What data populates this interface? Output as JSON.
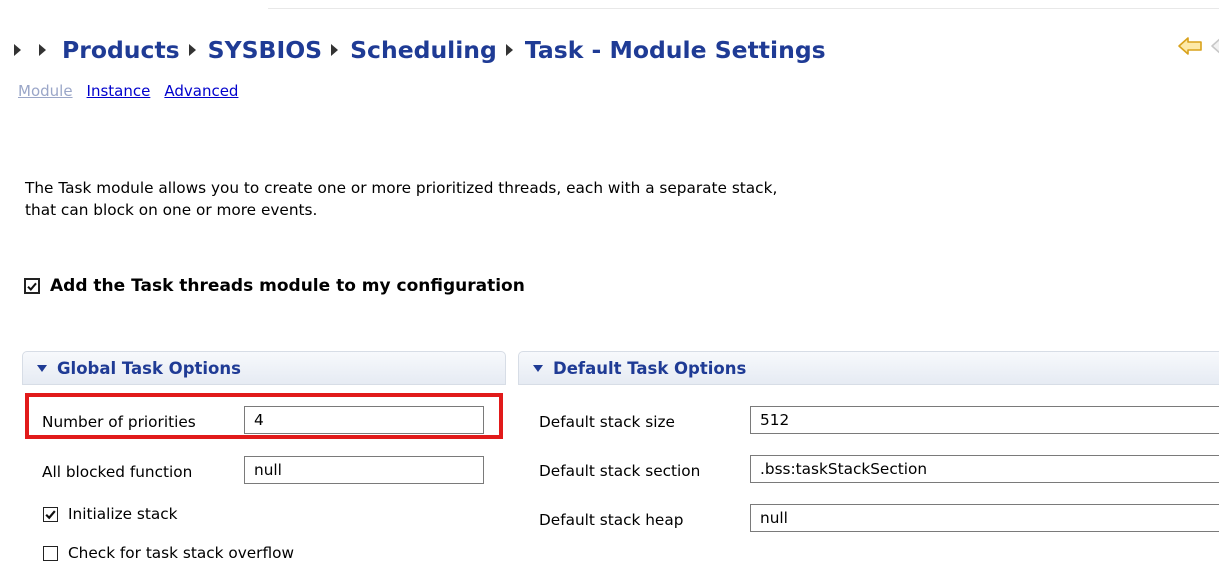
{
  "breadcrumb": {
    "items": [
      "Products",
      "SYSBIOS",
      "Scheduling",
      "Task - Module Settings"
    ]
  },
  "subtabs": [
    {
      "label": "Module",
      "active": true
    },
    {
      "label": "Instance",
      "active": false
    },
    {
      "label": "Advanced",
      "active": false
    }
  ],
  "description": {
    "line1": "The Task module allows you to create one or more prioritized threads, each with a separate stack,",
    "line2": "that can block on one or more events."
  },
  "enable_module": {
    "label": "Add the Task threads module to my configuration",
    "checked": true
  },
  "global_options": {
    "title": "Global Task Options",
    "num_priorities": {
      "label": "Number of priorities",
      "value": "4"
    },
    "all_blocked_fn": {
      "label": "All blocked function",
      "value": "null"
    },
    "initialize_stack": {
      "label": "Initialize stack",
      "checked": true
    },
    "check_overflow": {
      "label": "Check for task stack overflow",
      "checked": false
    }
  },
  "default_options": {
    "title": "Default Task Options",
    "stack_size": {
      "label": "Default stack size",
      "value": "512"
    },
    "stack_section": {
      "label": "Default stack section",
      "value": ".bss:taskStackSection"
    },
    "stack_heap": {
      "label": "Default stack heap",
      "value": "null"
    }
  },
  "colors": {
    "link": "#1f3b95",
    "highlight_box": "#e11a1a",
    "active_tab": "#9aa6c8"
  },
  "icons": {
    "back": "back-arrow-icon",
    "forward": "forward-arrow-icon"
  }
}
